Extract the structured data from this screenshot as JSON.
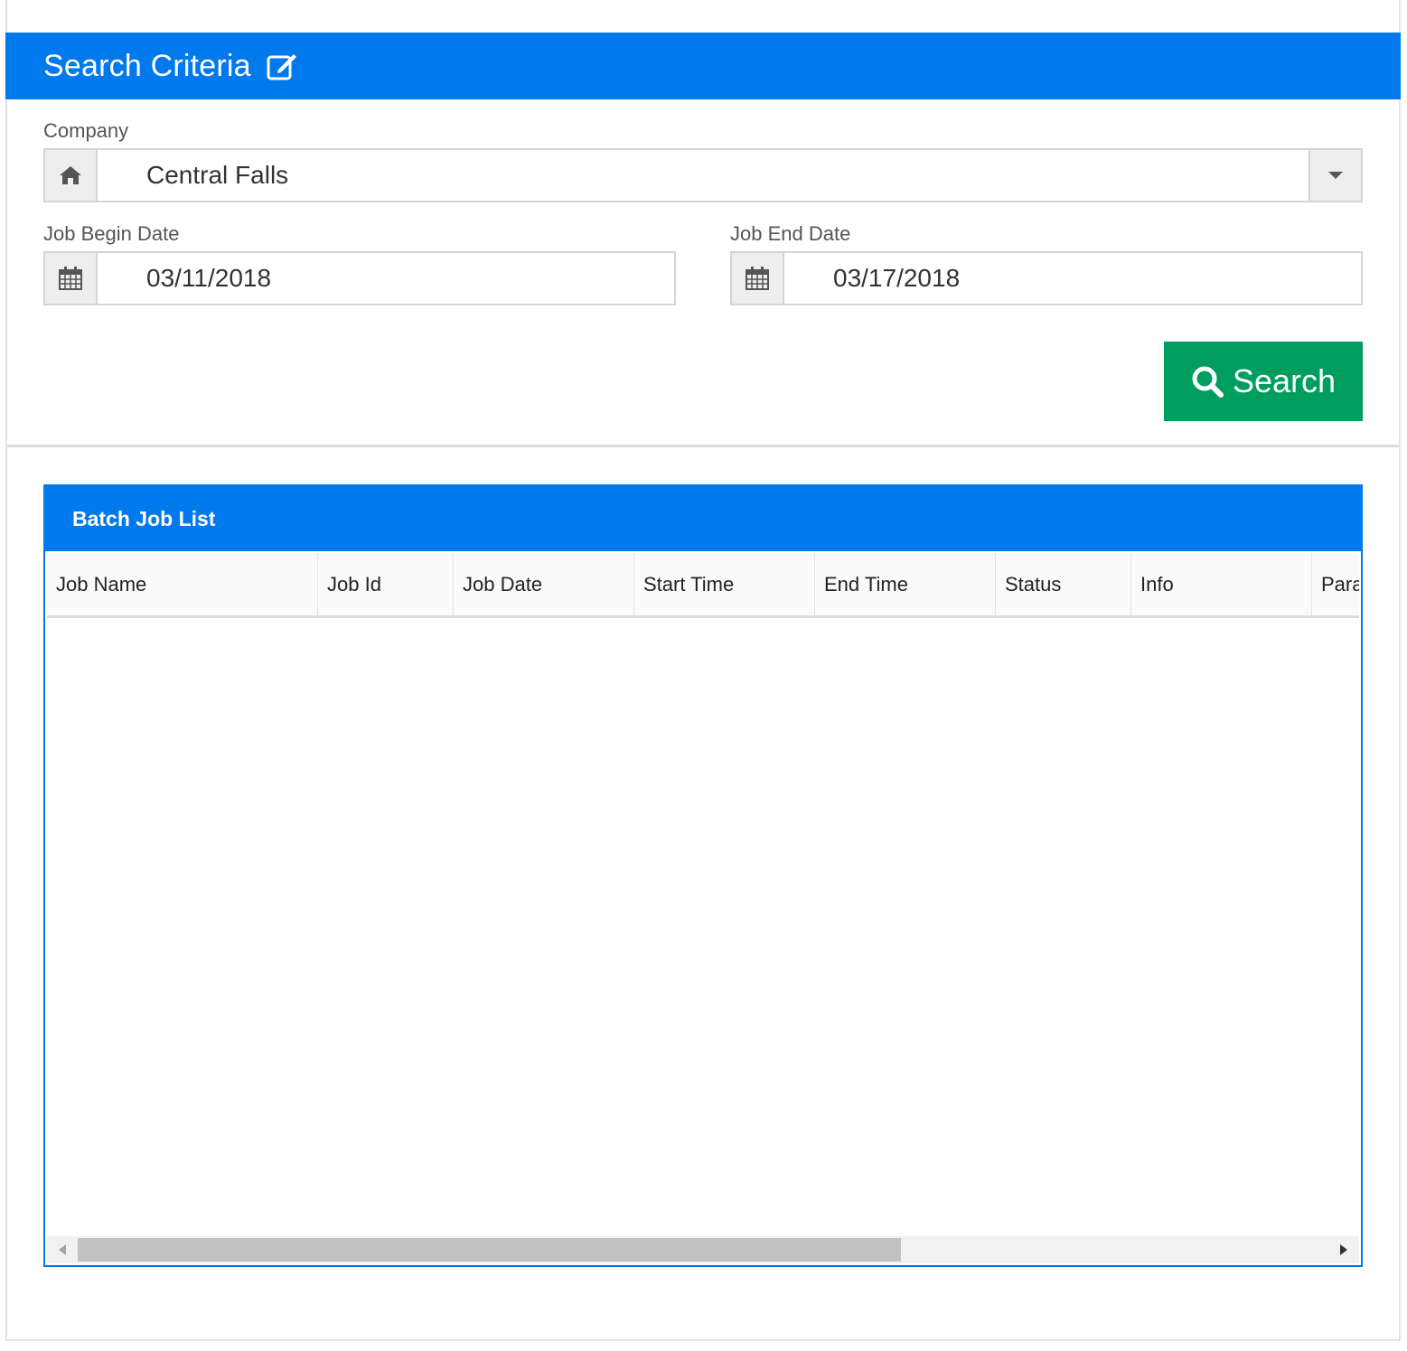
{
  "criteria": {
    "title": "Search Criteria",
    "icon": "edit-icon"
  },
  "company": {
    "label": "Company",
    "value": "Central Falls",
    "icon": "home-icon"
  },
  "begin_date": {
    "label": "Job Begin Date",
    "value": "03/11/2018",
    "icon": "calendar-icon"
  },
  "end_date": {
    "label": "Job End Date",
    "value": "03/17/2018",
    "icon": "calendar-icon"
  },
  "search_button": {
    "label": "Search",
    "icon": "search-icon"
  },
  "grid": {
    "title": "Batch Job List",
    "columns": [
      "Job Name",
      "Job Id",
      "Job Date",
      "Start Time",
      "End Time",
      "Status",
      "Info",
      "Para"
    ]
  },
  "colors": {
    "primary": "#0079ed",
    "success": "#009e5e",
    "addon_bg": "#eeeeee",
    "border": "#d4d4d4"
  }
}
